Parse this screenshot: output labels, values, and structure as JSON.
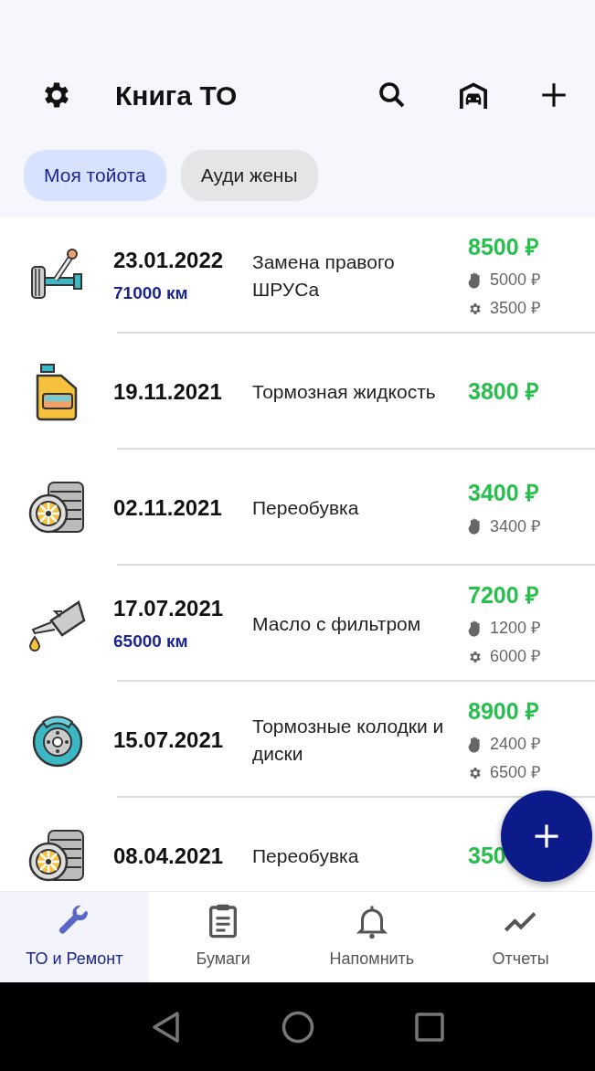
{
  "app_bar": {
    "title": "Книга ТО"
  },
  "chips": [
    {
      "label": "Моя тойота",
      "selected": true
    },
    {
      "label": "Ауди жены",
      "selected": false
    }
  ],
  "records": [
    {
      "kind": "suspension",
      "date": "23.01.2022",
      "mileage": "71000 км",
      "title": "Замена правого ШРУСа",
      "total": "8500 ₽",
      "costs": [
        {
          "kind": "work",
          "amount": "5000 ₽"
        },
        {
          "kind": "parts",
          "amount": "3500 ₽"
        }
      ]
    },
    {
      "kind": "fluid",
      "date": "19.11.2021",
      "title": "Тормозная жидкость",
      "total": "3800 ₽"
    },
    {
      "kind": "tires",
      "date": "02.11.2021",
      "title": "Переобувка",
      "total": "3400 ₽",
      "costs": [
        {
          "kind": "work",
          "amount": "3400 ₽"
        }
      ]
    },
    {
      "kind": "oil",
      "date": "17.07.2021",
      "mileage": "65000 км",
      "title": "Масло с фильтром",
      "total": "7200 ₽",
      "costs": [
        {
          "kind": "work",
          "amount": "1200 ₽"
        },
        {
          "kind": "parts",
          "amount": "6000 ₽"
        }
      ]
    },
    {
      "kind": "brakes",
      "date": "15.07.2021",
      "title": "Тормозные колодки и диски",
      "total": "8900 ₽",
      "costs": [
        {
          "kind": "work",
          "amount": "2400 ₽"
        },
        {
          "kind": "parts",
          "amount": "6500 ₽"
        }
      ]
    },
    {
      "kind": "tires",
      "date": "08.04.2021",
      "title": "Переобувка",
      "total": "350"
    }
  ],
  "bottom_nav": [
    {
      "kind": "wrench",
      "label": "ТО и Ремонт",
      "selected": true
    },
    {
      "kind": "clipboard",
      "label": "Бумаги",
      "selected": false
    },
    {
      "kind": "bell",
      "label": "Напомнить",
      "selected": false
    },
    {
      "kind": "chart",
      "label": "Отчеты",
      "selected": false
    }
  ]
}
